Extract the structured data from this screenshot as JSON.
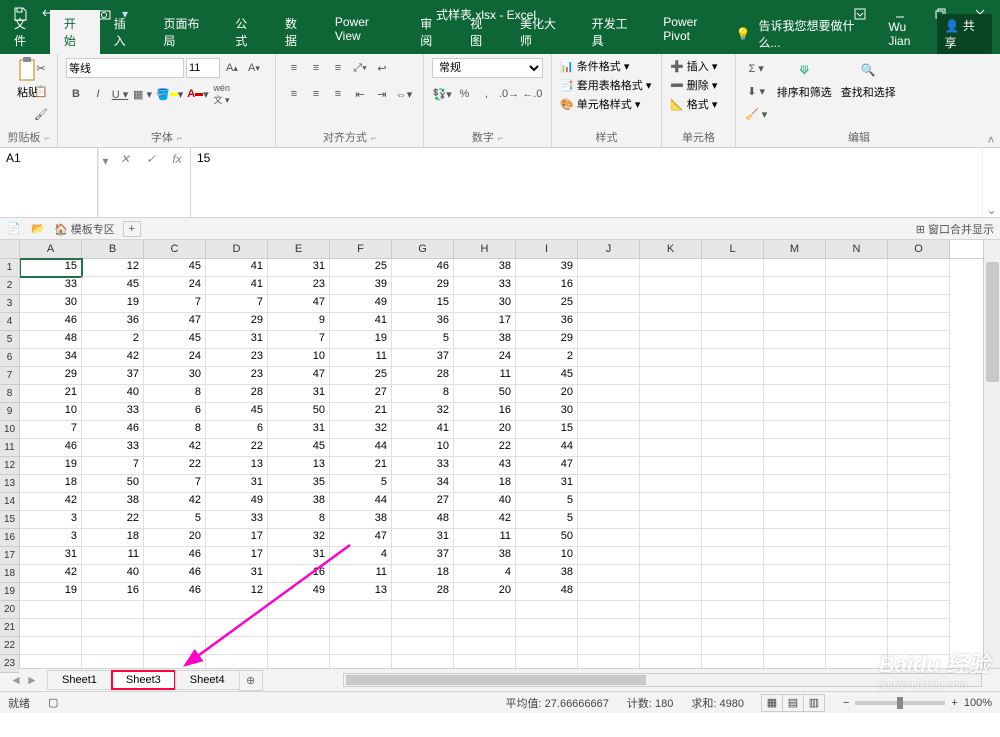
{
  "title": "式样表.xlsx - Excel",
  "qat": {
    "icons": [
      "save-icon",
      "undo-icon",
      "redo-icon",
      "camera-icon"
    ]
  },
  "window_controls": [
    "minimize",
    "restore",
    "close"
  ],
  "tabs": [
    "文件",
    "开始",
    "插入",
    "页面布局",
    "公式",
    "数据",
    "Power View",
    "审阅",
    "视图",
    "美化大师",
    "开发工具",
    "Power Pivot"
  ],
  "active_tab": "开始",
  "tell_me": "告诉我您想要做什么...",
  "user": "Wu Jian",
  "share": "共享",
  "ribbon": {
    "clipboard": {
      "paste": "粘贴",
      "title": "剪贴板"
    },
    "font": {
      "name": "等线",
      "size": "11",
      "title": "字体",
      "buttons": [
        "B",
        "I",
        "U"
      ]
    },
    "alignment": {
      "title": "对齐方式"
    },
    "number": {
      "format": "常规",
      "title": "数字"
    },
    "styles": {
      "conditional": "条件格式",
      "table": "套用表格格式",
      "cell": "单元格样式",
      "title": "样式"
    },
    "cells": {
      "insert": "插入",
      "delete": "删除",
      "format": "格式",
      "title": "单元格"
    },
    "editing": {
      "sort": "排序和筛选",
      "find": "查找和选择",
      "title": "编辑"
    }
  },
  "name_box": "A1",
  "formula_value": "15",
  "secondary": {
    "template": "模板专区",
    "merge": "窗口合并显示"
  },
  "columns": [
    "A",
    "B",
    "C",
    "D",
    "E",
    "F",
    "G",
    "H",
    "I",
    "J",
    "K",
    "L",
    "M",
    "N",
    "O"
  ],
  "rows": [
    [
      15,
      12,
      45,
      41,
      31,
      25,
      46,
      38,
      39
    ],
    [
      33,
      45,
      24,
      41,
      23,
      39,
      29,
      33,
      16
    ],
    [
      30,
      19,
      7,
      7,
      47,
      49,
      15,
      30,
      25
    ],
    [
      46,
      36,
      47,
      29,
      9,
      41,
      36,
      17,
      36
    ],
    [
      48,
      2,
      45,
      31,
      7,
      19,
      5,
      38,
      29
    ],
    [
      34,
      42,
      24,
      23,
      10,
      11,
      37,
      24,
      2
    ],
    [
      29,
      37,
      30,
      23,
      47,
      25,
      28,
      11,
      45
    ],
    [
      21,
      40,
      8,
      28,
      31,
      27,
      8,
      50,
      20
    ],
    [
      10,
      33,
      6,
      45,
      50,
      21,
      32,
      16,
      30
    ],
    [
      7,
      46,
      8,
      6,
      31,
      32,
      41,
      20,
      15
    ],
    [
      46,
      33,
      42,
      22,
      45,
      44,
      10,
      22,
      44
    ],
    [
      19,
      7,
      22,
      13,
      13,
      21,
      33,
      43,
      47
    ],
    [
      18,
      50,
      7,
      31,
      35,
      5,
      34,
      18,
      31
    ],
    [
      42,
      38,
      42,
      49,
      38,
      44,
      27,
      40,
      5
    ],
    [
      3,
      22,
      5,
      33,
      8,
      38,
      48,
      42,
      5
    ],
    [
      3,
      18,
      20,
      17,
      32,
      47,
      31,
      11,
      50
    ],
    [
      31,
      11,
      46,
      17,
      31,
      4,
      37,
      38,
      10
    ],
    [
      42,
      40,
      46,
      31,
      16,
      11,
      18,
      4,
      38
    ],
    [
      19,
      16,
      46,
      12,
      49,
      13,
      28,
      20,
      48
    ]
  ],
  "empty_rows": 4,
  "row_count": 23,
  "sheets": [
    "Sheet1",
    "Sheet3",
    "Sheet4"
  ],
  "highlighted_sheet": "Sheet3",
  "status": {
    "ready": "就绪",
    "avg_label": "平均值:",
    "avg": "27.66666667",
    "count_label": "计数:",
    "count": "180",
    "sum_label": "求和:",
    "sum": "4980",
    "zoom": "100%"
  },
  "watermark": {
    "big": "Baidu 经验",
    "small": "jingyan.baidu.com"
  }
}
